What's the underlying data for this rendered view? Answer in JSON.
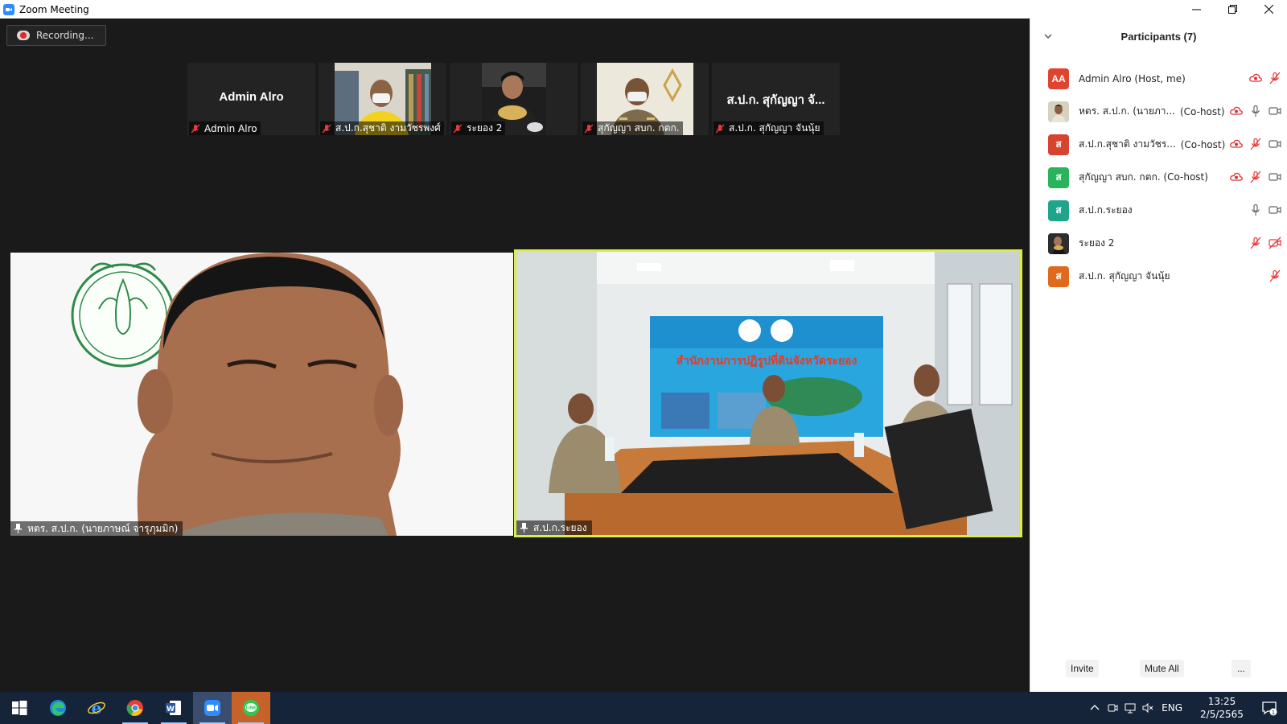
{
  "window": {
    "title": "Zoom Meeting",
    "controls": [
      "minimize",
      "restore",
      "close"
    ]
  },
  "recording": {
    "label": "Recording..."
  },
  "thumbnails": [
    {
      "display": "Admin Alro",
      "label": "Admin Alro",
      "muted": true
    },
    {
      "label": "ส.ป.ก.สุชาติ งามวัชรพงศ์",
      "muted": true
    },
    {
      "label": "ระยอง 2",
      "muted": true
    },
    {
      "label": "สุกัญญา สบก. กตก.",
      "muted": true
    },
    {
      "display": "ส.ป.ก. สุกัญญา จั...",
      "label": "ส.ป.ก. สุกัญญา จันนุ้ย",
      "muted": true
    }
  ],
  "main_videos": [
    {
      "label": "หตร. ส.ป.ก. (นายภาษณ์ จารุภุมมิก)",
      "pinned": true
    },
    {
      "label": "ส.ป.ก.ระยอง",
      "pinned": true,
      "active_speaker": true,
      "banner_text": "สำนักงานการปฏิรูปที่ดินจังหวัดระยอง"
    }
  ],
  "participants": {
    "title": "Participants (7)",
    "items": [
      {
        "initials": "AA",
        "color": "#e0442f",
        "name": "Admin Alro (Host, me)",
        "role": "",
        "recording": true,
        "mic": "muted",
        "video": "none"
      },
      {
        "initials": "",
        "photo": true,
        "name": "หตร. ส.ป.ก. (นายภา...",
        "role": "(Co-host)",
        "recording": true,
        "mic": "on",
        "video": "on"
      },
      {
        "initials": "ส",
        "color": "#d6432e",
        "name": "ส.ป.ก.สุชาติ งามวัชร...",
        "role": "(Co-host)",
        "recording": true,
        "mic": "muted",
        "video": "on"
      },
      {
        "initials": "ส",
        "color": "#27b45a",
        "name": "สุกัญญา สบก. กตก. (Co-host)",
        "role": "",
        "recording": true,
        "mic": "muted",
        "video": "on"
      },
      {
        "initials": "ส",
        "color": "#1fa58a",
        "name": "ส.ป.ก.ระยอง",
        "role": "",
        "recording": false,
        "mic": "on",
        "video": "on"
      },
      {
        "initials": "",
        "photo": true,
        "name": "ระยอง 2",
        "role": "",
        "recording": false,
        "mic": "muted",
        "video": "off"
      },
      {
        "initials": "ส",
        "color": "#e06a1c",
        "name": "ส.ป.ก. สุกัญญา จันนุ้ย",
        "role": "",
        "recording": false,
        "mic": "muted",
        "video": "none"
      }
    ],
    "footer": {
      "invite": "Invite",
      "mute_all": "Mute All",
      "more": "..."
    }
  },
  "taskbar": {
    "apps": [
      "windows-start",
      "edge",
      "internet-explorer",
      "chrome",
      "word",
      "zoom",
      "line"
    ],
    "language": "ENG",
    "time": "13:25",
    "date": "2/5/2565",
    "notifications": "1"
  }
}
